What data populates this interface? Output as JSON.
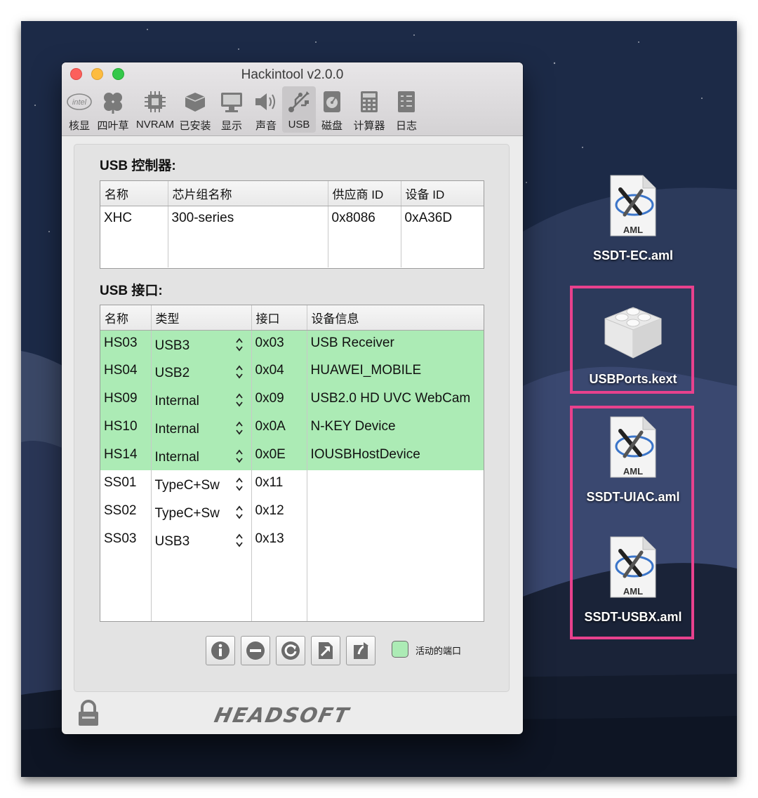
{
  "window": {
    "title": "Hackintool v2.0.0"
  },
  "toolbar": {
    "items": [
      {
        "label": "核显",
        "icon": "intel-icon"
      },
      {
        "label": "四叶草",
        "icon": "clover-icon"
      },
      {
        "label": "NVRAM",
        "icon": "chip-icon"
      },
      {
        "label": "已安装",
        "icon": "kext-installed-icon"
      },
      {
        "label": "显示",
        "icon": "display-icon"
      },
      {
        "label": "声音",
        "icon": "speaker-icon"
      },
      {
        "label": "USB",
        "icon": "usb-icon",
        "active": true
      },
      {
        "label": "磁盘",
        "icon": "disk-icon"
      },
      {
        "label": "计算器",
        "icon": "calculator-icon"
      },
      {
        "label": "日志",
        "icon": "log-icon"
      }
    ]
  },
  "usb_controllers": {
    "title": "USB 控制器:",
    "columns": [
      "名称",
      "芯片组名称",
      "供应商 ID",
      "设备 ID"
    ],
    "rows": [
      {
        "name": "XHC",
        "chipset": "300-series",
        "vendor_id": "0x8086",
        "device_id": "0xA36D"
      }
    ]
  },
  "usb_ports": {
    "title": "USB 接口:",
    "columns": [
      "名称",
      "类型",
      "接口",
      "设备信息"
    ],
    "rows": [
      {
        "name": "HS03",
        "type": "USB3",
        "port": "0x03",
        "info": "USB Receiver",
        "active": true
      },
      {
        "name": "HS04",
        "type": "USB2",
        "port": "0x04",
        "info": "HUAWEI_MOBILE",
        "active": true
      },
      {
        "name": "HS09",
        "type": "Internal",
        "port": "0x09",
        "info": "USB2.0 HD UVC WebCam",
        "active": true
      },
      {
        "name": "HS10",
        "type": "Internal",
        "port": "0x0A",
        "info": "N-KEY Device",
        "active": true
      },
      {
        "name": "HS14",
        "type": "Internal",
        "port": "0x0E",
        "info": "IOUSBHostDevice",
        "active": true
      },
      {
        "name": "SS01",
        "type": "TypeC+Sw",
        "port": "0x11",
        "info": "",
        "active": false
      },
      {
        "name": "SS02",
        "type": "TypeC+Sw",
        "port": "0x12",
        "info": "",
        "active": false
      },
      {
        "name": "SS03",
        "type": "USB3",
        "port": "0x13",
        "info": "",
        "active": false
      }
    ]
  },
  "bottom_buttons": [
    "info-icon",
    "remove-icon",
    "refresh-icon",
    "export-icon",
    "import-icon"
  ],
  "legend": {
    "label": "活动的端口",
    "color": "#acebb5"
  },
  "brand": "HEADSOFT",
  "desktop_files": [
    {
      "name": "SSDT-EC.aml",
      "badge": "AML",
      "highlighted": false
    },
    {
      "name": "USBPorts.kext",
      "highlighted": true
    },
    {
      "name": "SSDT-UIAC.aml",
      "badge": "AML",
      "highlighted": true
    },
    {
      "name": "SSDT-USBX.aml",
      "badge": "AML",
      "highlighted": true
    }
  ],
  "colors": {
    "active_port": "#acebb5",
    "highlight": "#e8418d"
  }
}
